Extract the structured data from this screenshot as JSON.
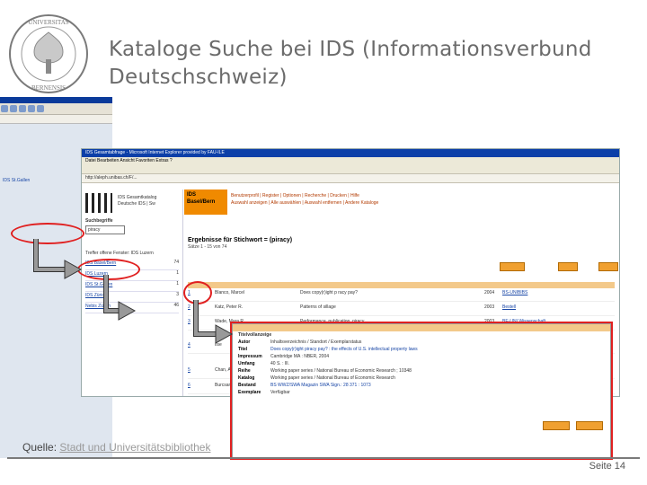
{
  "header": {
    "title": "Kataloge Suche bei IDS (Informationsverbund Deutschschweiz)"
  },
  "footer": {
    "source_label": "Quelle:",
    "source_link": "Stadt und Universitätsbibliothek",
    "page": "Seite 14"
  },
  "logo": {
    "text": "UNIVERSITAS BERNENSIS"
  },
  "screenshot": {
    "window_title": "IDS Gesamtabfrage - Microsoft Internet Explorer provided by FAU-ILE",
    "menu": "Datei  Bearbeiten  Ansicht  Favoriten  Extras  ?",
    "address": "http://aleph.unibas.ch/F/...",
    "left_panel": {
      "catalog_label": "IDS Gesamtkatalog",
      "catalog_sub": "Deutsche IDS | Sw",
      "search_label": "Suchbegriffe",
      "search_value": "piracy",
      "results_head": "Treffer offene Fenster: IDS Luzern",
      "results": [
        {
          "name": "IDS Basel/Bern",
          "count": "74"
        },
        {
          "name": "IDS Luzern",
          "count": "1"
        },
        {
          "name": "IDS St.Gallen",
          "count": "1"
        },
        {
          "name": "IDS Zürich",
          "count": "3"
        },
        {
          "name": "Nebis Zürich",
          "count": "46"
        }
      ]
    },
    "banner": {
      "logo": "IDS Basel/Bern",
      "nav1": "Benutzerprofil | Register | Optionen | Recherche | Drucken | Hilfe",
      "nav2": "Auswahl anzeigen | Alle auswählen | Auswahl entfernen | Andere Kataloge"
    },
    "results_title": "Ergebnisse für Stichwort = (piracy)",
    "results_sub": "Sätze 1 - 15 von 74",
    "rows": [
      {
        "n": "1",
        "author": "Blanco, Marcel",
        "title": "Does copy(r)ight p racy pay?",
        "year": "2004",
        "holding": "BS-UNIBIBS"
      },
      {
        "n": "2",
        "author": "Katz, Peter R.",
        "title": "Patterns of sillage",
        "year": "2003",
        "holding": "Bestell"
      },
      {
        "n": "3",
        "author": "Wade, Mara R.",
        "title": "Performance, publication, piracy",
        "year": "2003",
        "holding": "BE-UNI Wissenschaft"
      },
      {
        "n": "4",
        "author": "Ilse",
        "title": "",
        "year": "",
        "holding": ""
      },
      {
        "n": "5",
        "author": "Chan, A.",
        "title": "",
        "year": "",
        "holding": ""
      },
      {
        "n": "6",
        "author": "Burcsan",
        "title": "",
        "year": "",
        "holding": ""
      }
    ],
    "detail": {
      "title": "Titelvollanzeige",
      "lines": [
        {
          "k": "Autor",
          "v": "Inhaltsverzeichnis / Standort / Exemplarstatus"
        },
        {
          "k": "Titel",
          "v": "Does copy(r)ight piracy pay? : the effects of U.S. intellectual property laws"
        },
        {
          "k": "Impressum",
          "v": "Cambridge MA : NBER, 2004"
        },
        {
          "k": "Umfang",
          "v": "40 S. : Ill."
        },
        {
          "k": "Reihe",
          "v": "Working paper series / National Bureau of Economic Research ; 10348"
        },
        {
          "k": "Katalog",
          "v": "Working paper series / National Bureau of Economic Research"
        },
        {
          "k": "Bestand",
          "v": "BS WWZ/SWA Magazin SWA Sign.: 28 371 : 1073"
        },
        {
          "k": "Exemplare",
          "v": "Verfügbar"
        }
      ]
    }
  },
  "colors": {
    "accent_red": "#e02020",
    "ids_orange": "#f08a00",
    "ie_blue": "#0c3fa8"
  }
}
